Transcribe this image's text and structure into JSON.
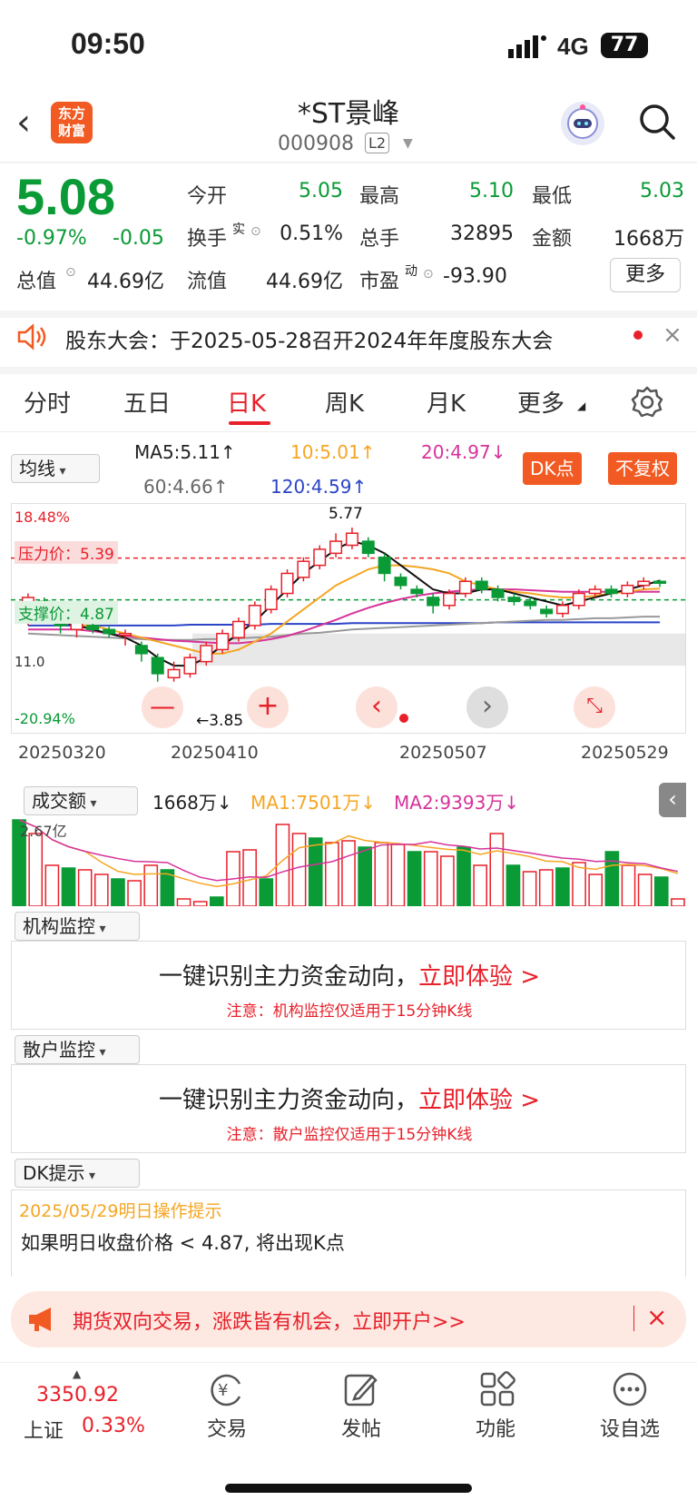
{
  "status": {
    "time": "09:50",
    "network": "4G",
    "battery": "77"
  },
  "header": {
    "name": "*ST景峰",
    "code": "000908",
    "level": "L2",
    "logo_text": [
      "东方",
      "财富"
    ]
  },
  "quote": {
    "price": "5.08",
    "pct": "-0.97%",
    "change": "-0.05",
    "open_label": "今开",
    "open": "5.05",
    "high_label": "最高",
    "high": "5.10",
    "low_label": "最低",
    "low": "5.03",
    "turnover_label": "换手",
    "turnover_sup": "实",
    "turnover": "0.51%",
    "volume_label": "总手",
    "volume": "32895",
    "amount_label": "金额",
    "amount": "1668万",
    "mktcap_label": "总值",
    "mktcap": "44.69亿",
    "float_label": "流值",
    "float": "44.69亿",
    "pe_label": "市盈",
    "pe_sup": "动",
    "pe": "-93.90",
    "more": "更多"
  },
  "notice": {
    "text": "股东大会：于2025-05-28召开2024年年度股东大会"
  },
  "tabs": [
    "分时",
    "五日",
    "日K",
    "周K",
    "月K",
    "更多"
  ],
  "ma": {
    "selector": "均线",
    "ma5": "MA5:5.11↑",
    "ma10": "10:5.01↑",
    "ma20": "20:4.97↓",
    "ma60": "60:4.66↑",
    "ma120": "120:4.59↑",
    "dk_button": "DK点",
    "fq_button": "不复权"
  },
  "chart_labels": {
    "top_pct": "18.48%",
    "bottom_pct": "-20.94%",
    "high_mark": "5.77",
    "low_mark": "←3.85",
    "pressure": "压力价：5.39",
    "support": "支撑价：4.87",
    "left_mark": "11.0",
    "dates": [
      "20250320",
      "20250410",
      "20250507",
      "20250529"
    ]
  },
  "chart_data": {
    "type": "candlestick",
    "x": [
      "20250320",
      "20250410",
      "20250507",
      "20250529"
    ],
    "price_range": [
      3.85,
      5.77
    ],
    "pressure": 5.39,
    "support": 4.87,
    "candles": [
      [
        4.7,
        4.9,
        4.95,
        4.55
      ],
      [
        4.85,
        4.7,
        4.9,
        4.6
      ],
      [
        4.6,
        4.55,
        4.75,
        4.45
      ],
      [
        4.5,
        4.6,
        4.7,
        4.4
      ],
      [
        4.55,
        4.5,
        4.6,
        4.45
      ],
      [
        4.5,
        4.45,
        4.55,
        4.4
      ],
      [
        4.45,
        4.45,
        4.5,
        4.3
      ],
      [
        4.3,
        4.2,
        4.35,
        4.1
      ],
      [
        4.15,
        3.95,
        4.2,
        3.85
      ],
      [
        3.9,
        4.0,
        4.1,
        3.85
      ],
      [
        3.95,
        4.15,
        4.2,
        3.9
      ],
      [
        4.1,
        4.3,
        4.35,
        4.05
      ],
      [
        4.25,
        4.45,
        4.5,
        4.2
      ],
      [
        4.4,
        4.6,
        4.65,
        4.35
      ],
      [
        4.55,
        4.8,
        4.85,
        4.5
      ],
      [
        4.75,
        5.0,
        5.05,
        4.7
      ],
      [
        4.95,
        5.2,
        5.25,
        4.9
      ],
      [
        5.15,
        5.35,
        5.4,
        5.1
      ],
      [
        5.3,
        5.5,
        5.55,
        5.25
      ],
      [
        5.45,
        5.6,
        5.7,
        5.4
      ],
      [
        5.55,
        5.7,
        5.77,
        5.5
      ],
      [
        5.6,
        5.45,
        5.65,
        5.4
      ],
      [
        5.4,
        5.2,
        5.45,
        5.1
      ],
      [
        5.15,
        5.05,
        5.2,
        5.0
      ],
      [
        5.0,
        4.95,
        5.05,
        4.9
      ],
      [
        4.9,
        4.8,
        4.95,
        4.7
      ],
      [
        4.8,
        4.95,
        5.0,
        4.75
      ],
      [
        4.95,
        5.1,
        5.15,
        4.9
      ],
      [
        5.1,
        5.0,
        5.15,
        4.95
      ],
      [
        5.0,
        4.9,
        5.05,
        4.85
      ],
      [
        4.9,
        4.85,
        4.95,
        4.8
      ],
      [
        4.85,
        4.8,
        4.9,
        4.75
      ],
      [
        4.75,
        4.7,
        4.8,
        4.65
      ],
      [
        4.7,
        4.8,
        4.85,
        4.65
      ],
      [
        4.8,
        4.95,
        5.0,
        4.75
      ],
      [
        4.95,
        5.0,
        5.05,
        4.9
      ],
      [
        5.0,
        4.95,
        5.05,
        4.9
      ],
      [
        4.95,
        5.05,
        5.1,
        4.9
      ],
      [
        5.05,
        5.1,
        5.15,
        5.0
      ],
      [
        5.1,
        5.08,
        5.12,
        5.03
      ]
    ],
    "ma5": [
      4.8,
      4.7,
      4.6,
      4.55,
      4.5,
      4.45,
      4.4,
      4.3,
      4.15,
      4.05,
      4.05,
      4.15,
      4.3,
      4.45,
      4.6,
      4.8,
      5.0,
      5.2,
      5.35,
      5.5,
      5.6,
      5.55,
      5.45,
      5.3,
      5.15,
      5.0,
      4.95,
      4.95,
      5.0,
      5.0,
      4.95,
      4.9,
      4.85,
      4.8,
      4.85,
      4.9,
      4.95,
      5.0,
      5.05,
      5.11
    ],
    "ma10": [
      4.6,
      4.6,
      4.6,
      4.55,
      4.55,
      4.5,
      4.45,
      4.4,
      4.35,
      4.3,
      4.25,
      4.2,
      4.2,
      4.25,
      4.35,
      4.45,
      4.6,
      4.75,
      4.9,
      5.05,
      5.15,
      5.25,
      5.3,
      5.3,
      5.28,
      5.25,
      5.2,
      5.1,
      5.05,
      5.0,
      4.97,
      4.95,
      4.92,
      4.9,
      4.9,
      4.92,
      4.95,
      4.97,
      5.0,
      5.01
    ],
    "ma20": [
      4.5,
      4.5,
      4.5,
      4.5,
      4.48,
      4.45,
      4.42,
      4.4,
      4.38,
      4.36,
      4.35,
      4.34,
      4.33,
      4.33,
      4.35,
      4.38,
      4.42,
      4.48,
      4.55,
      4.62,
      4.7,
      4.77,
      4.83,
      4.88,
      4.92,
      4.95,
      4.97,
      4.99,
      5.0,
      5.0,
      5.0,
      4.99,
      4.98,
      4.97,
      4.97,
      4.97,
      4.97,
      4.97,
      4.97,
      4.97
    ],
    "ma60": [
      4.45,
      4.44,
      4.43,
      4.42,
      4.41,
      4.4,
      4.39,
      4.38,
      4.37,
      4.37,
      4.37,
      4.38,
      4.38,
      4.39,
      4.4,
      4.41,
      4.43,
      4.45,
      4.46,
      4.48,
      4.5,
      4.51,
      4.52,
      4.53,
      4.54,
      4.55,
      4.56,
      4.57,
      4.58,
      4.59,
      4.6,
      4.61,
      4.62,
      4.62,
      4.63,
      4.64,
      4.64,
      4.65,
      4.66,
      4.66
    ],
    "ma120": [
      4.55,
      4.55,
      4.55,
      4.55,
      4.55,
      4.55,
      4.55,
      4.55,
      4.55,
      4.55,
      4.56,
      4.56,
      4.56,
      4.56,
      4.56,
      4.57,
      4.57,
      4.57,
      4.57,
      4.57,
      4.58,
      4.58,
      4.58,
      4.58,
      4.58,
      4.58,
      4.58,
      4.58,
      4.58,
      4.59,
      4.59,
      4.59,
      4.59,
      4.59,
      4.59,
      4.59,
      4.59,
      4.59,
      4.59,
      4.59
    ]
  },
  "volume": {
    "selector": "成交额",
    "current": "1668万↓",
    "ma1": "MA1:7501万↓",
    "ma2": "MA2:9393万↓",
    "top": "2.67亿",
    "bars": [
      0.95,
      0.8,
      0.45,
      0.42,
      0.4,
      0.35,
      0.3,
      0.28,
      0.45,
      0.4,
      0.08,
      0.05,
      0.1,
      0.6,
      0.62,
      0.3,
      0.9,
      0.8,
      0.75,
      0.7,
      0.72,
      0.65,
      0.7,
      0.68,
      0.6,
      0.6,
      0.55,
      0.65,
      0.45,
      0.8,
      0.45,
      0.38,
      0.4,
      0.42,
      0.48,
      0.35,
      0.6,
      0.45,
      0.35,
      0.32,
      0.08
    ]
  },
  "monitor1": {
    "selector": "机构监控",
    "title": "一键识别主力资金动向，",
    "cta": "立即体验 >",
    "note": "注意：机构监控仅适用于15分钟K线"
  },
  "monitor2": {
    "selector": "散户监控",
    "title": "一键识别主力资金动向，",
    "cta": "立即体验 >",
    "note": "注意：散户监控仅适用于15分钟K线"
  },
  "dk": {
    "selector": "DK提示",
    "date": "2025/05/29明日操作提示",
    "text": "如果明日收盘价格 < 4.87, 将出现K点"
  },
  "promo": {
    "text": "期货双向交易，涨跌皆有机会，立即开户>>"
  },
  "bottom": {
    "index_value": "3350.92",
    "index_name": "上证",
    "index_pct": "0.33%",
    "items": [
      "交易",
      "发帖",
      "功能",
      "设自选"
    ]
  }
}
